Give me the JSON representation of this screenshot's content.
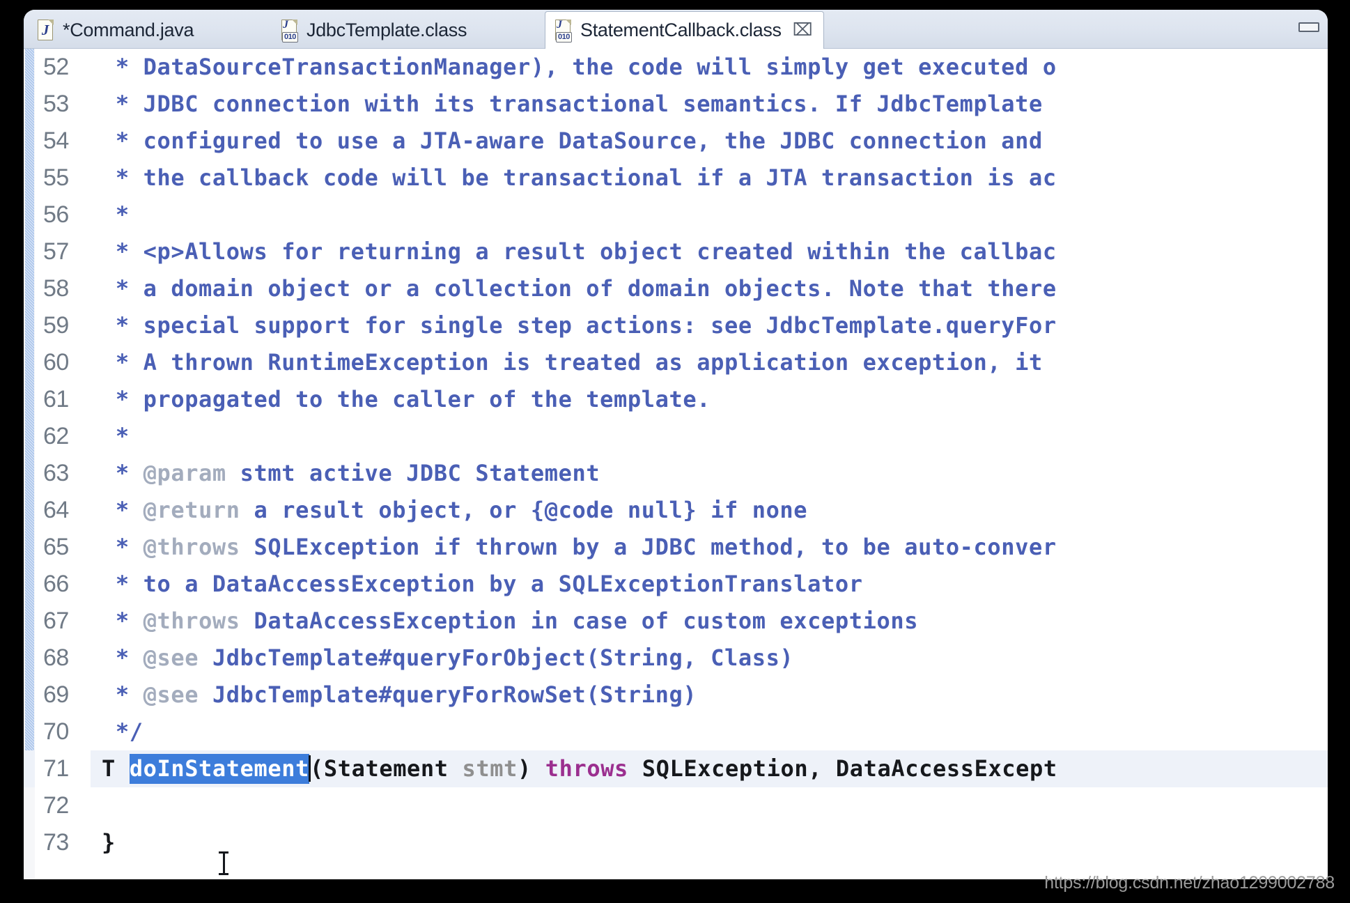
{
  "window": {
    "minimize_label": "minimize"
  },
  "tabs": [
    {
      "label": "*Command.java",
      "icon": "java-file-icon",
      "active": false,
      "closable": false
    },
    {
      "label": "JdbcTemplate.class",
      "icon": "class-file-icon",
      "active": false,
      "closable": false
    },
    {
      "label": "StatementCallback.class",
      "icon": "class-file-icon",
      "active": true,
      "closable": true,
      "close_glyph": "⌧"
    }
  ],
  "editor": {
    "first_line": 52,
    "current_line": 71,
    "selection_text": "doInStatement",
    "lines": [
      {
        "num": "52",
        "text": " * DataSourceTransactionManager), the code will simply get executed o"
      },
      {
        "num": "53",
        "text": " * JDBC connection with its transactional semantics. If JdbcTemplate"
      },
      {
        "num": "54",
        "text": " * configured to use a JTA-aware DataSource, the JDBC connection and"
      },
      {
        "num": "55",
        "text": " * the callback code will be transactional if a JTA transaction is ac"
      },
      {
        "num": "56",
        "text": " *"
      },
      {
        "num": "57",
        "text": " * <p>Allows for returning a result object created within the callbac"
      },
      {
        "num": "58",
        "text": " * a domain object or a collection of domain objects. Note that there"
      },
      {
        "num": "59",
        "text": " * special support for single step actions: see JdbcTemplate.queryFor"
      },
      {
        "num": "60",
        "text": " * A thrown RuntimeException is treated as application exception, it "
      },
      {
        "num": "61",
        "text": " * propagated to the caller of the template."
      },
      {
        "num": "62",
        "text": " *"
      },
      {
        "num": "63",
        "text": " * @param stmt active JDBC Statement"
      },
      {
        "num": "64",
        "text": " * @return a result object, or {@code null} if none"
      },
      {
        "num": "65",
        "text": " * @throws SQLException if thrown by a JDBC method, to be auto-conver"
      },
      {
        "num": "66",
        "text": " * to a DataAccessException by a SQLExceptionTranslator"
      },
      {
        "num": "67",
        "text": " * @throws DataAccessException in case of custom exceptions"
      },
      {
        "num": "68",
        "text": " * @see JdbcTemplate#queryForObject(String, Class)"
      },
      {
        "num": "69",
        "text": " * @see JdbcTemplate#queryForRowSet(String)"
      },
      {
        "num": "70",
        "text": " */"
      },
      {
        "num": "71",
        "text": "T doInStatement(Statement stmt) throws SQLException, DataAccessExcept"
      },
      {
        "num": "72",
        "text": ""
      },
      {
        "num": "73",
        "text": "}"
      }
    ],
    "tokens": {
      "l52": [
        {
          "t": " * DataSourceTransactionManager), the code will simply get executed o",
          "c": "jd"
        }
      ],
      "l53": [
        {
          "t": " * JDBC connection with its transactional semantics. If JdbcTemplate",
          "c": "jd"
        }
      ],
      "l54": [
        {
          "t": " * configured to use a JTA-aware DataSource, the JDBC connection and",
          "c": "jd"
        }
      ],
      "l55": [
        {
          "t": " * the callback code will be transactional if a JTA transaction is ac",
          "c": "jd"
        }
      ],
      "l56": [
        {
          "t": " *",
          "c": "jd"
        }
      ],
      "l57": [
        {
          "t": " * <p>Allows for returning a result object created within the callbac",
          "c": "jd"
        }
      ],
      "l58": [
        {
          "t": " * a domain object or a collection of domain objects. Note that there",
          "c": "jd"
        }
      ],
      "l59": [
        {
          "t": " * special support for single step actions: see JdbcTemplate.queryFor",
          "c": "jd"
        }
      ],
      "l60": [
        {
          "t": " * A thrown RuntimeException is treated as application exception, it ",
          "c": "jd"
        }
      ],
      "l61": [
        {
          "t": " * propagated to the caller of the template.",
          "c": "jd"
        }
      ],
      "l62": [
        {
          "t": " *",
          "c": "jd"
        }
      ],
      "l63": [
        {
          "t": " * ",
          "c": "jd"
        },
        {
          "t": "@param",
          "c": "jdtag"
        },
        {
          "t": " stmt active JDBC Statement",
          "c": "jd"
        }
      ],
      "l64": [
        {
          "t": " * ",
          "c": "jd"
        },
        {
          "t": "@return",
          "c": "jdtag"
        },
        {
          "t": " a result object, or {@code null} if none",
          "c": "jd"
        }
      ],
      "l65": [
        {
          "t": " * ",
          "c": "jd"
        },
        {
          "t": "@throws",
          "c": "jdtag"
        },
        {
          "t": " SQLException if thrown by a JDBC method, to be auto-conver",
          "c": "jd"
        }
      ],
      "l66": [
        {
          "t": " * to a DataAccessException by a SQLExceptionTranslator",
          "c": "jd"
        }
      ],
      "l67": [
        {
          "t": " * ",
          "c": "jd"
        },
        {
          "t": "@throws",
          "c": "jdtag"
        },
        {
          "t": " DataAccessException in case of custom exceptions",
          "c": "jd"
        }
      ],
      "l68": [
        {
          "t": " * ",
          "c": "jd"
        },
        {
          "t": "@see",
          "c": "jdtag"
        },
        {
          "t": " JdbcTemplate#queryForObject(String, Class)",
          "c": "jd"
        }
      ],
      "l69": [
        {
          "t": " * ",
          "c": "jd"
        },
        {
          "t": "@see",
          "c": "jdtag"
        },
        {
          "t": " JdbcTemplate#queryForRowSet(String)",
          "c": "jd"
        }
      ],
      "l70": [
        {
          "t": " */",
          "c": "jd"
        }
      ],
      "l71": [
        {
          "t": "T ",
          "c": "plain"
        },
        {
          "t": "doInStatement",
          "c": "sel"
        },
        {
          "t": "|CARET|",
          "c": "caret"
        },
        {
          "t": "(Statement ",
          "c": "plain"
        },
        {
          "t": "stmt",
          "c": "param"
        },
        {
          "t": ") ",
          "c": "plain"
        },
        {
          "t": "throws",
          "c": "kw"
        },
        {
          "t": " SQLException, DataAccessExcept",
          "c": "plain"
        }
      ],
      "l72": [
        {
          "t": "",
          "c": "plain"
        }
      ],
      "l73": [
        {
          "t": "}",
          "c": "plain"
        }
      ]
    }
  },
  "watermark": {
    "text": "https://blog.csdn.net/zhao1299002788"
  }
}
